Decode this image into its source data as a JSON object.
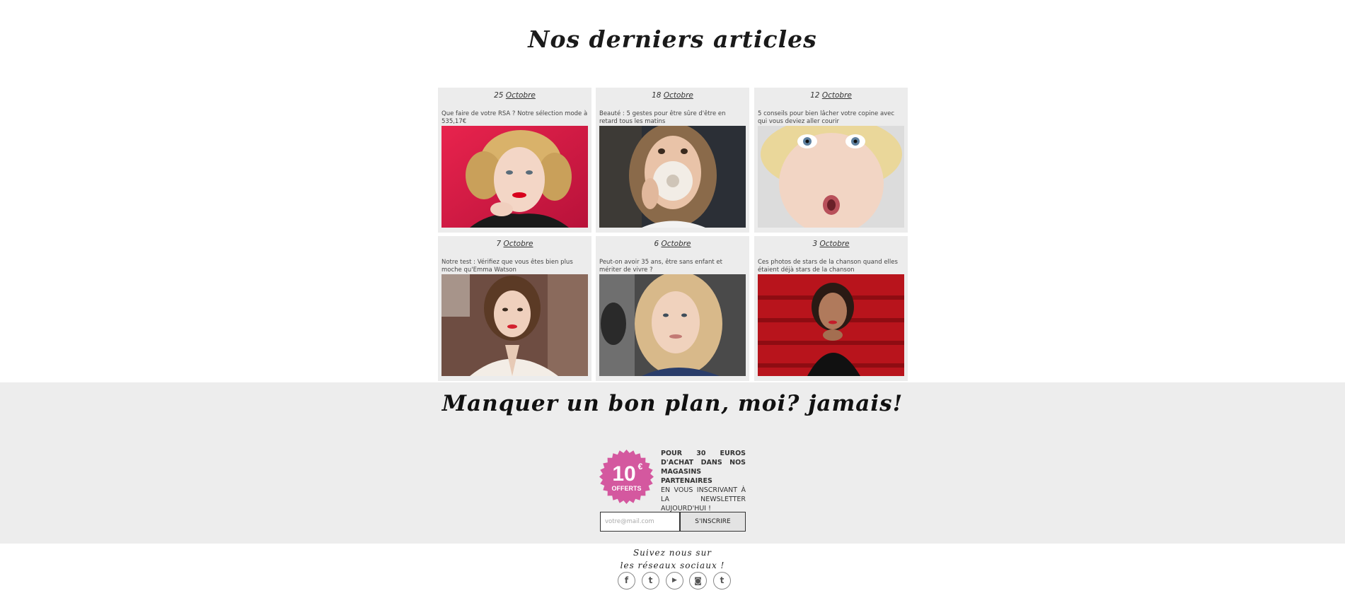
{
  "articles": {
    "heading": "Nos derniers articles",
    "items": [
      {
        "day": "25",
        "month": "Octobre",
        "title": "Que faire de votre RSA ? Notre sélection mode à 535,17€"
      },
      {
        "day": "18",
        "month": "Octobre",
        "title": "Beauté : 5 gestes pour être sûre d'être en retard tous les matins"
      },
      {
        "day": "12",
        "month": "Octobre",
        "title": "5 conseils pour bien lâcher votre copine avec qui vous deviez aller courir"
      },
      {
        "day": "7",
        "month": "Octobre",
        "title": "Notre test : Vérifiez que vous êtes bien plus moche qu'Emma Watson"
      },
      {
        "day": "6",
        "month": "Octobre",
        "title": "Peut-on avoir 35 ans, être sans enfant et mériter de vivre ?"
      },
      {
        "day": "3",
        "month": "Octobre",
        "title": "Ces photos de stars de la chanson quand elles étaient déjà stars de la chanson"
      }
    ]
  },
  "newsletter": {
    "heading": "Manquer un bon plan, moi? jamais!",
    "badge_amount": "10",
    "badge_currency": "€",
    "badge_label": "OFFERTS",
    "offer_bold": "POUR 30 EUROS D'ACHAT DANS NOS MAGASINS PARTENAIRES",
    "offer_text": "EN VOUS INSCRIVANT À LA NEWSLETTER AUJOURD'HUI !",
    "email_placeholder": "votre@mail.com",
    "subscribe_label": "S'INSCRIRE",
    "badge_color": "#d4589f"
  },
  "social": {
    "line1": "Suivez nous sur",
    "line2": "les réseaux sociaux !",
    "icons": [
      {
        "name": "facebook-icon",
        "glyph": "f"
      },
      {
        "name": "twitter-icon",
        "glyph": "t"
      },
      {
        "name": "youtube-icon",
        "glyph": "▶"
      },
      {
        "name": "instagram-icon",
        "glyph": "◙"
      },
      {
        "name": "tumblr-icon",
        "glyph": "t"
      }
    ]
  }
}
